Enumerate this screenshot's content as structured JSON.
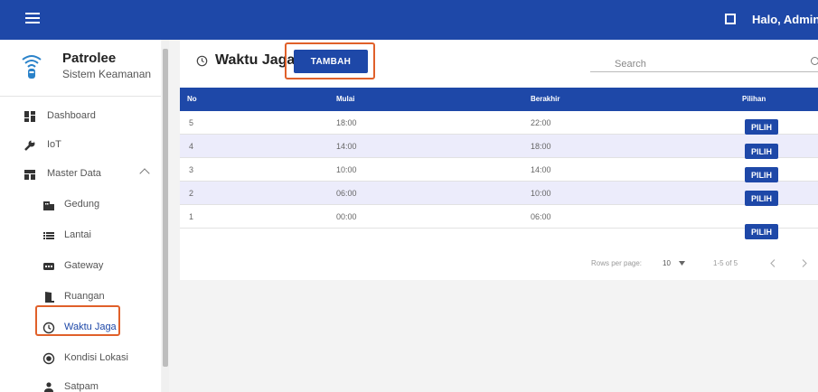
{
  "header": {
    "greeting": "Halo, Admin"
  },
  "sidebar": {
    "brand_title": "Patrolee",
    "brand_subtitle": "Sistem Keamanan",
    "items": [
      {
        "label": "Dashboard",
        "icon": "dashboard-icon"
      },
      {
        "label": "IoT",
        "icon": "wrench-icon"
      },
      {
        "label": "Master Data",
        "icon": "storage-icon"
      },
      {
        "label": "Gedung",
        "icon": "building-icon"
      },
      {
        "label": "Lantai",
        "icon": "list-icon"
      },
      {
        "label": "Gateway",
        "icon": "gateway-icon"
      },
      {
        "label": "Ruangan",
        "icon": "door-icon"
      },
      {
        "label": "Waktu Jaga",
        "icon": "clock-icon"
      },
      {
        "label": "Kondisi Lokasi",
        "icon": "radio-icon"
      },
      {
        "label": "Satpam",
        "icon": "person-icon"
      }
    ]
  },
  "main": {
    "title": "Waktu Jaga",
    "add_label": "TAMBAH",
    "search_placeholder": "Search",
    "table": {
      "headers": [
        "No",
        "Mulai",
        "Berakhir",
        "Pilihan"
      ],
      "rows": [
        {
          "no": "5",
          "mulai": "18:00",
          "berakhir": "22:00",
          "action": "PILIH"
        },
        {
          "no": "4",
          "mulai": "14:00",
          "berakhir": "18:00",
          "action": "PILIH"
        },
        {
          "no": "3",
          "mulai": "10:00",
          "berakhir": "14:00",
          "action": "PILIH"
        },
        {
          "no": "2",
          "mulai": "06:00",
          "berakhir": "10:00",
          "action": "PILIH"
        },
        {
          "no": "1",
          "mulai": "00:00",
          "berakhir": "06:00",
          "action": "PILIH"
        }
      ]
    },
    "pagination": {
      "rows_per_page_label": "Rows per page:",
      "rows_per_page_value": "10",
      "range": "1-5 of 5"
    }
  },
  "colors": {
    "primary": "#1e48a8",
    "highlight": "#e0602a",
    "row_alt": "#ececfb"
  }
}
